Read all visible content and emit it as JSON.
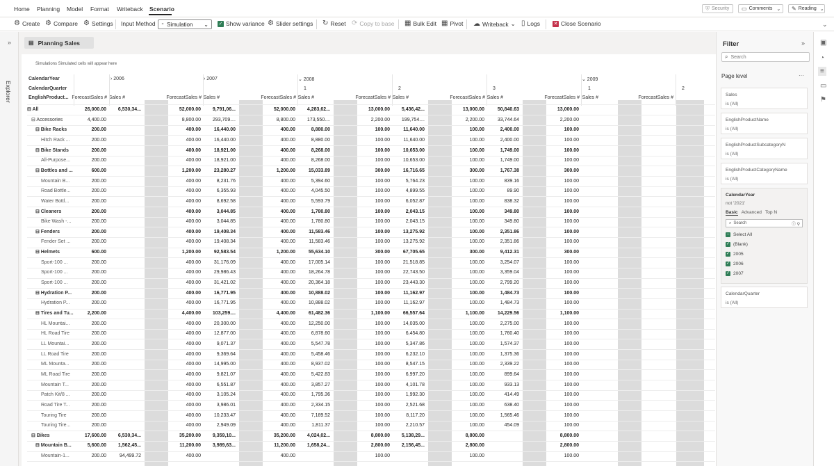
{
  "menubar": {
    "tabs": [
      "Home",
      "Planning",
      "Model",
      "Format",
      "Writeback",
      "Scenario"
    ],
    "active": "Scenario",
    "security": "Security",
    "comments": "Comments",
    "reading": "Reading"
  },
  "toolbar": {
    "create": "Create",
    "compare": "Compare",
    "settings": "Settings",
    "input_method": "Input Method",
    "simulation": "Simulation",
    "show_variance": "Show variance",
    "slider_settings": "Slider settings",
    "reset": "Reset",
    "copy_to_base": "Copy to base",
    "bulk_edit": "Bulk Edit",
    "pivot": "Pivot",
    "writeback": "Writeback",
    "logs": "Logs",
    "close_scenario": "Close Scenario"
  },
  "explorer": {
    "label": "Explorer"
  },
  "page": {
    "tab_label": "Planning Sales",
    "sim_note": "Simulations  Simulated cells will appear here"
  },
  "grid": {
    "row_headers": [
      "CalendarYear",
      "CalendarQuarter",
      "EnglishProduct..."
    ],
    "years": [
      "2006",
      "2007",
      "2008",
      "2009"
    ],
    "quarters": [
      "1",
      "2",
      "3",
      "1",
      "2"
    ],
    "measures": [
      "ForecastSales",
      "Sales"
    ],
    "rows": [
      {
        "label": "All",
        "level": 0,
        "bold": true,
        "expander": "⊟",
        "v": [
          "26,000.00",
          "6,530,34...",
          "52,000.00",
          "9,791,06...",
          "52,000.00",
          "4,283,62...",
          "13,000.00",
          "5,436,42...",
          "13,000.00",
          "50,840.63",
          "13,000.00",
          "",
          ""
        ]
      },
      {
        "label": "Accessories",
        "level": 1,
        "bold": false,
        "expander": "⊟",
        "v": [
          "4,400.00",
          "",
          "8,800.00",
          "293,709....",
          "8,800.00",
          "173,550....",
          "2,200.00",
          "199,754....",
          "2,200.00",
          "33,744.64",
          "2,200.00",
          "",
          ""
        ]
      },
      {
        "label": "Bike Racks",
        "level": 2,
        "bold": true,
        "expander": "⊟",
        "v": [
          "200.00",
          "",
          "400.00",
          "16,440.00",
          "400.00",
          "8,880.00",
          "100.00",
          "11,640.00",
          "100.00",
          "2,400.00",
          "100.00",
          "",
          ""
        ]
      },
      {
        "label": "Hitch Rack ...",
        "level": 3,
        "bold": false,
        "expander": "",
        "v": [
          "200.00",
          "",
          "400.00",
          "16,440.00",
          "400.00",
          "8,880.00",
          "100.00",
          "11,640.00",
          "100.00",
          "2,400.00",
          "100.00",
          "",
          ""
        ]
      },
      {
        "label": "Bike Stands",
        "level": 2,
        "bold": true,
        "expander": "⊟",
        "v": [
          "200.00",
          "",
          "400.00",
          "18,921.00",
          "400.00",
          "8,268.00",
          "100.00",
          "10,653.00",
          "100.00",
          "1,749.00",
          "100.00",
          "",
          ""
        ]
      },
      {
        "label": "All-Purpose...",
        "level": 3,
        "bold": false,
        "expander": "",
        "v": [
          "200.00",
          "",
          "400.00",
          "18,921.00",
          "400.00",
          "8,268.00",
          "100.00",
          "10,653.00",
          "100.00",
          "1,749.00",
          "100.00",
          "",
          ""
        ]
      },
      {
        "label": "Bottles and ...",
        "level": 2,
        "bold": true,
        "expander": "⊟",
        "v": [
          "600.00",
          "",
          "1,200.00",
          "23,280.27",
          "1,200.00",
          "15,033.89",
          "300.00",
          "16,716.65",
          "300.00",
          "1,767.38",
          "300.00",
          "",
          ""
        ]
      },
      {
        "label": "Mountain B...",
        "level": 3,
        "bold": false,
        "expander": "",
        "v": [
          "200.00",
          "",
          "400.00",
          "8,231.76",
          "400.00",
          "5,394.60",
          "100.00",
          "5,764.23",
          "100.00",
          "839.16",
          "100.00",
          "",
          ""
        ]
      },
      {
        "label": "Road Bottle...",
        "level": 3,
        "bold": false,
        "expander": "",
        "v": [
          "200.00",
          "",
          "400.00",
          "6,355.93",
          "400.00",
          "4,045.50",
          "100.00",
          "4,899.55",
          "100.00",
          "89.90",
          "100.00",
          "",
          ""
        ]
      },
      {
        "label": "Water Bottl...",
        "level": 3,
        "bold": false,
        "expander": "",
        "v": [
          "200.00",
          "",
          "400.00",
          "8,692.58",
          "400.00",
          "5,593.79",
          "100.00",
          "6,052.87",
          "100.00",
          "838.32",
          "100.00",
          "",
          ""
        ]
      },
      {
        "label": "Cleaners",
        "level": 2,
        "bold": true,
        "expander": "⊟",
        "v": [
          "200.00",
          "",
          "400.00",
          "3,044.85",
          "400.00",
          "1,780.80",
          "100.00",
          "2,043.15",
          "100.00",
          "349.80",
          "100.00",
          "",
          ""
        ]
      },
      {
        "label": "Bike Wash -...",
        "level": 3,
        "bold": false,
        "expander": "",
        "v": [
          "200.00",
          "",
          "400.00",
          "3,044.85",
          "400.00",
          "1,780.80",
          "100.00",
          "2,043.15",
          "100.00",
          "349.80",
          "100.00",
          "",
          ""
        ]
      },
      {
        "label": "Fenders",
        "level": 2,
        "bold": true,
        "expander": "⊟",
        "v": [
          "200.00",
          "",
          "400.00",
          "19,408.34",
          "400.00",
          "11,583.46",
          "100.00",
          "13,275.92",
          "100.00",
          "2,351.86",
          "100.00",
          "",
          ""
        ]
      },
      {
        "label": "Fender Set ...",
        "level": 3,
        "bold": false,
        "expander": "",
        "v": [
          "200.00",
          "",
          "400.00",
          "19,408.34",
          "400.00",
          "11,583.46",
          "100.00",
          "13,275.92",
          "100.00",
          "2,351.86",
          "100.00",
          "",
          ""
        ]
      },
      {
        "label": "Helmets",
        "level": 2,
        "bold": true,
        "expander": "⊟",
        "v": [
          "600.00",
          "",
          "1,200.00",
          "92,583.54",
          "1,200.00",
          "55,634.10",
          "300.00",
          "67,705.65",
          "300.00",
          "9,412.31",
          "300.00",
          "",
          ""
        ]
      },
      {
        "label": "Sport-100 ...",
        "level": 3,
        "bold": false,
        "expander": "",
        "v": [
          "200.00",
          "",
          "400.00",
          "31,176.09",
          "400.00",
          "17,005.14",
          "100.00",
          "21,518.85",
          "100.00",
          "3,254.07",
          "100.00",
          "",
          ""
        ]
      },
      {
        "label": "Sport-100 ...",
        "level": 3,
        "bold": false,
        "expander": "",
        "v": [
          "200.00",
          "",
          "400.00",
          "29,986.43",
          "400.00",
          "18,264.78",
          "100.00",
          "22,743.50",
          "100.00",
          "3,359.04",
          "100.00",
          "",
          ""
        ]
      },
      {
        "label": "Sport-100 ...",
        "level": 3,
        "bold": false,
        "expander": "",
        "v": [
          "200.00",
          "",
          "400.00",
          "31,421.02",
          "400.00",
          "20,364.18",
          "100.00",
          "23,443.30",
          "100.00",
          "2,799.20",
          "100.00",
          "",
          ""
        ]
      },
      {
        "label": "Hydration P...",
        "level": 2,
        "bold": true,
        "expander": "⊟",
        "v": [
          "200.00",
          "",
          "400.00",
          "16,771.95",
          "400.00",
          "10,888.02",
          "100.00",
          "11,162.97",
          "100.00",
          "1,484.73",
          "100.00",
          "",
          ""
        ]
      },
      {
        "label": "Hydration P...",
        "level": 3,
        "bold": false,
        "expander": "",
        "v": [
          "200.00",
          "",
          "400.00",
          "16,771.95",
          "400.00",
          "10,888.02",
          "100.00",
          "11,162.97",
          "100.00",
          "1,484.73",
          "100.00",
          "",
          ""
        ]
      },
      {
        "label": "Tires and Tu...",
        "level": 2,
        "bold": true,
        "expander": "⊟",
        "v": [
          "2,200.00",
          "",
          "4,400.00",
          "103,259....",
          "4,400.00",
          "61,482.36",
          "1,100.00",
          "66,557.64",
          "1,100.00",
          "14,229.56",
          "1,100.00",
          "",
          ""
        ]
      },
      {
        "label": "HL Mountai...",
        "level": 3,
        "bold": false,
        "expander": "",
        "v": [
          "200.00",
          "",
          "400.00",
          "20,300.00",
          "400.00",
          "12,250.00",
          "100.00",
          "14,035.00",
          "100.00",
          "2,275.00",
          "100.00",
          "",
          ""
        ]
      },
      {
        "label": "HL Road Tire",
        "level": 3,
        "bold": false,
        "expander": "",
        "v": [
          "200.00",
          "",
          "400.00",
          "12,877.00",
          "400.00",
          "6,878.60",
          "100.00",
          "6,454.80",
          "100.00",
          "1,760.40",
          "100.00",
          "",
          ""
        ]
      },
      {
        "label": "LL Mountai...",
        "level": 3,
        "bold": false,
        "expander": "",
        "v": [
          "200.00",
          "",
          "400.00",
          "9,071.37",
          "400.00",
          "5,547.78",
          "100.00",
          "5,347.86",
          "100.00",
          "1,574.37",
          "100.00",
          "",
          ""
        ]
      },
      {
        "label": "LL Road Tire",
        "level": 3,
        "bold": false,
        "expander": "",
        "v": [
          "200.00",
          "",
          "400.00",
          "9,369.64",
          "400.00",
          "5,458.46",
          "100.00",
          "6,232.10",
          "100.00",
          "1,375.36",
          "100.00",
          "",
          ""
        ]
      },
      {
        "label": "ML Mounta...",
        "level": 3,
        "bold": false,
        "expander": "",
        "v": [
          "200.00",
          "",
          "400.00",
          "14,995.00",
          "400.00",
          "8,937.02",
          "100.00",
          "8,547.15",
          "100.00",
          "2,339.22",
          "100.00",
          "",
          ""
        ]
      },
      {
        "label": "ML Road Tire",
        "level": 3,
        "bold": false,
        "expander": "",
        "v": [
          "200.00",
          "",
          "400.00",
          "9,821.07",
          "400.00",
          "5,422.83",
          "100.00",
          "6,997.20",
          "100.00",
          "899.64",
          "100.00",
          "",
          ""
        ]
      },
      {
        "label": "Mountain T...",
        "level": 3,
        "bold": false,
        "expander": "",
        "v": [
          "200.00",
          "",
          "400.00",
          "6,551.87",
          "400.00",
          "3,857.27",
          "100.00",
          "4,101.78",
          "100.00",
          "933.13",
          "100.00",
          "",
          ""
        ]
      },
      {
        "label": "Patch Kit/8 ...",
        "level": 3,
        "bold": false,
        "expander": "",
        "v": [
          "200.00",
          "",
          "400.00",
          "3,105.24",
          "400.00",
          "1,795.36",
          "100.00",
          "1,992.30",
          "100.00",
          "414.49",
          "100.00",
          "",
          ""
        ]
      },
      {
        "label": "Road Tire T...",
        "level": 3,
        "bold": false,
        "expander": "",
        "v": [
          "200.00",
          "",
          "400.00",
          "3,986.01",
          "400.00",
          "2,334.15",
          "100.00",
          "2,521.68",
          "100.00",
          "638.40",
          "100.00",
          "",
          ""
        ]
      },
      {
        "label": "Touring Tire",
        "level": 3,
        "bold": false,
        "expander": "",
        "v": [
          "200.00",
          "",
          "400.00",
          "10,233.47",
          "400.00",
          "7,189.52",
          "100.00",
          "8,117.20",
          "100.00",
          "1,565.46",
          "100.00",
          "",
          ""
        ]
      },
      {
        "label": "Touring Tire...",
        "level": 3,
        "bold": false,
        "expander": "",
        "v": [
          "200.00",
          "",
          "400.00",
          "2,949.09",
          "400.00",
          "1,811.37",
          "100.00",
          "2,210.57",
          "100.00",
          "454.09",
          "100.00",
          "",
          ""
        ]
      },
      {
        "label": "Bikes",
        "level": 1,
        "bold": true,
        "expander": "⊟",
        "v": [
          "17,600.00",
          "6,530,34...",
          "35,200.00",
          "9,359,10...",
          "35,200.00",
          "4,024,02...",
          "8,800.00",
          "5,138,29...",
          "8,800.00",
          "",
          "8,800.00",
          "",
          ""
        ]
      },
      {
        "label": "Mountain B...",
        "level": 2,
        "bold": true,
        "expander": "⊟",
        "v": [
          "5,600.00",
          "1,562,45...",
          "11,200.00",
          "3,989,63...",
          "11,200.00",
          "1,658,24...",
          "2,800.00",
          "2,156,45...",
          "2,800.00",
          "",
          "2,800.00",
          "",
          ""
        ]
      },
      {
        "label": "Mountain-1...",
        "level": 3,
        "bold": false,
        "expander": "",
        "v": [
          "200.00",
          "94,499.72",
          "400.00",
          "",
          "400.00",
          "",
          "100.00",
          "",
          "100.00",
          "",
          "100.00",
          "",
          ""
        ]
      }
    ]
  },
  "filter": {
    "title": "Filter",
    "search_placeholder": "Search",
    "page_level": "Page level",
    "cards": [
      {
        "name": "Sales",
        "value": "is (All)"
      },
      {
        "name": "EnglishProductName",
        "value": "is (All)"
      },
      {
        "name": "EnglishProductSubcategoryN",
        "value": "is (All)"
      },
      {
        "name": "EnglishProductCategoryName",
        "value": "is (All)"
      }
    ],
    "expanded": {
      "name": "CalendarYear",
      "value": "not '2021'",
      "tabs": [
        "Basic",
        "Advanced",
        "Top N"
      ],
      "search": "Search",
      "options": [
        "Select All",
        "(Blank)",
        "2005",
        "2006",
        "2007"
      ]
    },
    "last_card": {
      "name": "CalendarQuarter",
      "value": "is (All)"
    }
  },
  "colors": {
    "accent_green": "#2f7d56",
    "close_red": "#c4314b",
    "grey_column": "#dcdcdc"
  }
}
